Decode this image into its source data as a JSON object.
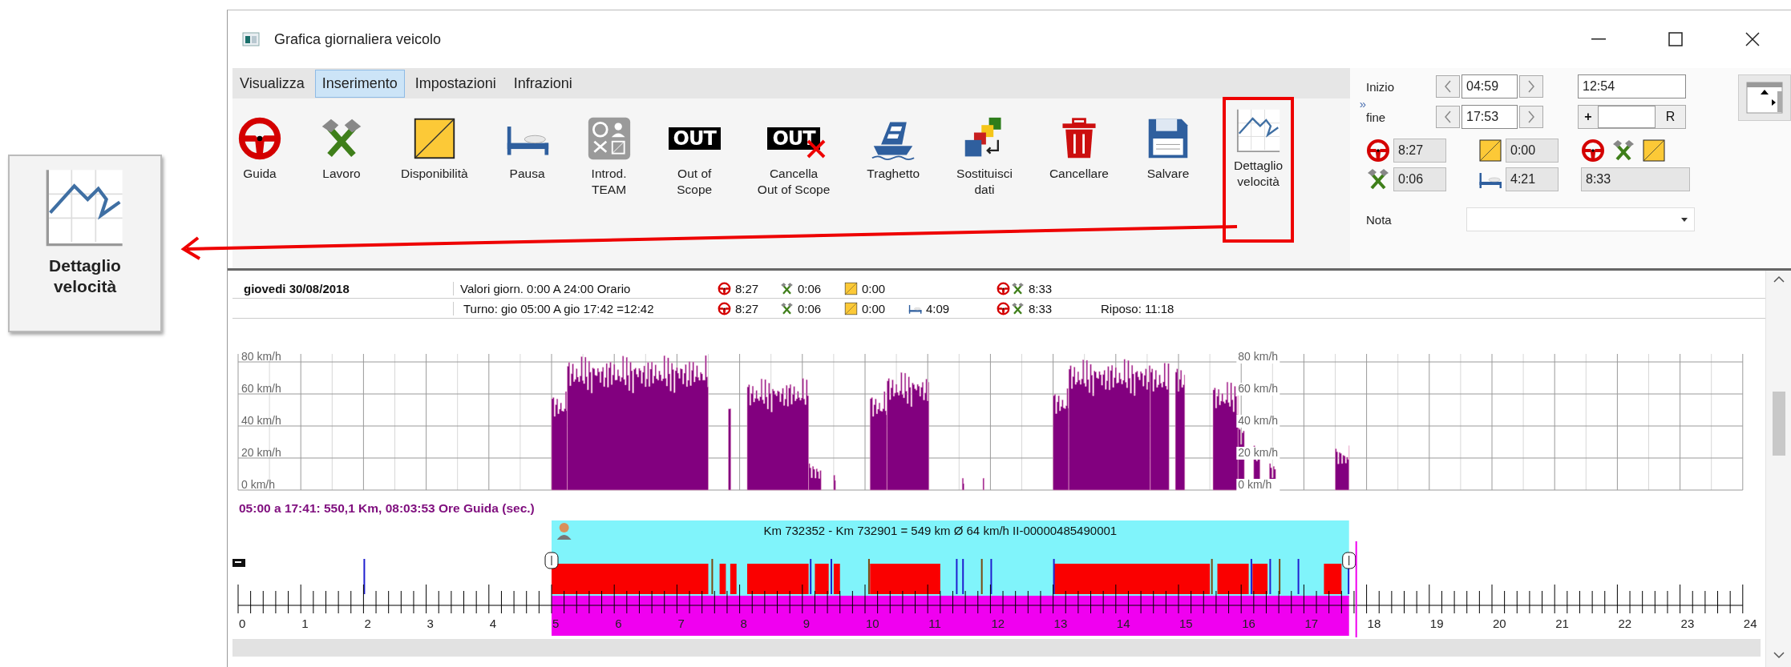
{
  "window": {
    "title": "Grafica giornaliera veicolo"
  },
  "callout": {
    "label": "Dettaglio velocità"
  },
  "menu": [
    {
      "label": "Visualizza",
      "selected": false
    },
    {
      "label": "Inserimento",
      "selected": true
    },
    {
      "label": "Impostazioni",
      "selected": false
    },
    {
      "label": "Infrazioni",
      "selected": false
    }
  ],
  "toolbar": [
    {
      "kind": "driving",
      "lines": [
        "Guida"
      ],
      "highlighted": false
    },
    {
      "kind": "work",
      "lines": [
        "Lavoro"
      ],
      "highlighted": false
    },
    {
      "kind": "availability",
      "lines": [
        "Disponibilità"
      ],
      "highlighted": false
    },
    {
      "kind": "rest",
      "lines": [
        "Pausa"
      ],
      "highlighted": false
    },
    {
      "kind": "team",
      "lines": [
        "Introd.",
        "TEAM"
      ],
      "highlighted": false
    },
    {
      "kind": "out",
      "icon_text": "OUT",
      "lines": [
        "Out of",
        "Scope"
      ],
      "highlighted": false
    },
    {
      "kind": "cancel_out",
      "icon_text": "OUT",
      "lines": [
        "Cancella",
        "Out of Scope"
      ],
      "highlighted": false
    },
    {
      "kind": "ferry",
      "lines": [
        "Traghetto"
      ],
      "highlighted": false
    },
    {
      "kind": "replace",
      "lines": [
        "Sostituisci",
        "dati"
      ],
      "highlighted": false
    },
    {
      "kind": "delete",
      "lines": [
        "Cancellare"
      ],
      "highlighted": false
    },
    {
      "kind": "save",
      "lines": [
        "Salvare"
      ],
      "highlighted": false
    },
    {
      "kind": "speed",
      "lines": [
        "Dettaglio",
        "velocità"
      ],
      "highlighted": true
    }
  ],
  "overflow": "»",
  "time": {
    "start_label": "Inizio",
    "start": "04:59",
    "end_label": "fine",
    "end": "17:53",
    "duration": "12:54",
    "offset_sign": "+",
    "reset": "R"
  },
  "totals": [
    {
      "kind": "driving",
      "value": "8:27"
    },
    {
      "kind": "availability",
      "value": "0:00"
    },
    {
      "kind": "work",
      "value": "0:06"
    },
    {
      "kind": "rest",
      "value": "4:21"
    }
  ],
  "combined": {
    "value": "8:33"
  },
  "note": {
    "label": "Nota"
  },
  "day": {
    "date": "giovedi 30/08/2018",
    "rows": [
      {
        "text": "Valori giorn. 0:00 A 24:00 Orario",
        "values": [
          {
            "kind": "driving",
            "value": "8:27"
          },
          {
            "kind": "work",
            "value": "0:06"
          },
          {
            "kind": "availability",
            "value": "0:00"
          },
          {
            "kind": "combined",
            "value": "8:33"
          }
        ]
      },
      {
        "text": "Turno: gio 05:00 A gio 17:42 =12:42",
        "values": [
          {
            "kind": "driving",
            "value": "8:27"
          },
          {
            "kind": "work",
            "value": "0:06"
          },
          {
            "kind": "availability",
            "value": "0:00"
          },
          {
            "kind": "rest",
            "value": "4:09"
          },
          {
            "kind": "combined",
            "value": "8:33"
          }
        ],
        "rest_note": "Riposo: 11:18"
      }
    ]
  },
  "speed_chart": {
    "y_labels": [
      "80 km/h",
      "60 km/h",
      "40 km/h",
      "20 km/h",
      "0 km/h"
    ],
    "y_labels_right": [
      "80 km/h",
      "60 km/h",
      "40 km/h",
      "20 km/h",
      "0 km/h"
    ]
  },
  "summary": "05:00 a 17:41: 550,1 Km,  08:03:53 Ore Guida (sec.)",
  "trip": "Km 732352 - Km 732901 = 549 km    Ø 64 km/h II-00000485490001",
  "hours": [
    "0",
    "1",
    "2",
    "3",
    "4",
    "5",
    "6",
    "7",
    "8",
    "9",
    "10",
    "11",
    "12",
    "13",
    "14",
    "15",
    "16",
    "17",
    "18",
    "19",
    "20",
    "21",
    "22",
    "23",
    "24"
  ]
}
